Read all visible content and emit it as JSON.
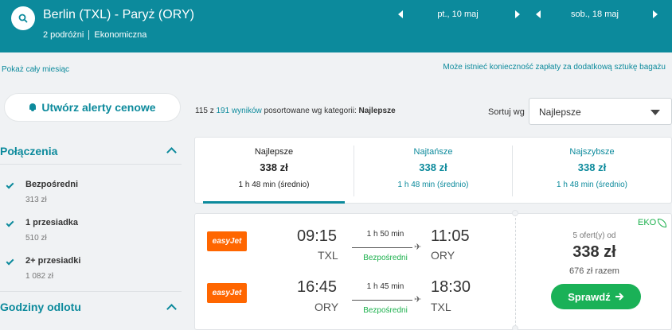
{
  "header": {
    "route": "Berlin (TXL) - Paryż (ORY)",
    "travelers": "2 podróżni",
    "cabin": "Ekonomiczna",
    "departure_date": "pt., 10 maj",
    "return_date": "sob., 18 maj"
  },
  "links": {
    "whole_month": "Pokaż cały miesiąc",
    "bag_notice": "Może istnieć konieczność zapłaty za dodatkową sztukę bagażu"
  },
  "sidebar": {
    "alert_button": "Utwórz alerty cenowe",
    "connections_title": "Połączenia",
    "filters": [
      {
        "label": "Bezpośredni",
        "price": "313 zł",
        "checked": true
      },
      {
        "label": "1 przesiadka",
        "price": "510 zł",
        "checked": true
      },
      {
        "label": "2+ przesiadki",
        "price": "1 082 zł",
        "checked": true
      }
    ],
    "departure_hours_title": "Godziny odlotu"
  },
  "results": {
    "shown": "115 z ",
    "total": "191 wyników",
    "sorted_by_text": " posortowane wg kategorii: ",
    "category": "Najlepsze"
  },
  "sort": {
    "label": "Sortuj wg",
    "selected": "Najlepsze"
  },
  "tabs": [
    {
      "title": "Najlepsze",
      "price": "338 zł",
      "duration": "1 h 48 min (średnio)",
      "active": true
    },
    {
      "title": "Najtańsze",
      "price": "338 zł",
      "duration": "1 h 48 min (średnio)",
      "active": false
    },
    {
      "title": "Najszybsze",
      "price": "338 zł",
      "duration": "1 h 48 min (średnio)",
      "active": false
    }
  ],
  "card": {
    "airline": "easyJet",
    "legs": [
      {
        "dep_time": "09:15",
        "dep_airport": "TXL",
        "duration": "1 h 50 min",
        "stops": "Bezpośredni",
        "arr_time": "11:05",
        "arr_airport": "ORY"
      },
      {
        "dep_time": "16:45",
        "dep_airport": "ORY",
        "duration": "1 h 45 min",
        "stops": "Bezpośredni",
        "arr_time": "18:30",
        "arr_airport": "TXL"
      }
    ],
    "eko": "EKO",
    "offers": "5 ofert(y) od",
    "price": "338 zł",
    "total": "676 zł razem",
    "button": "Sprawdź"
  }
}
